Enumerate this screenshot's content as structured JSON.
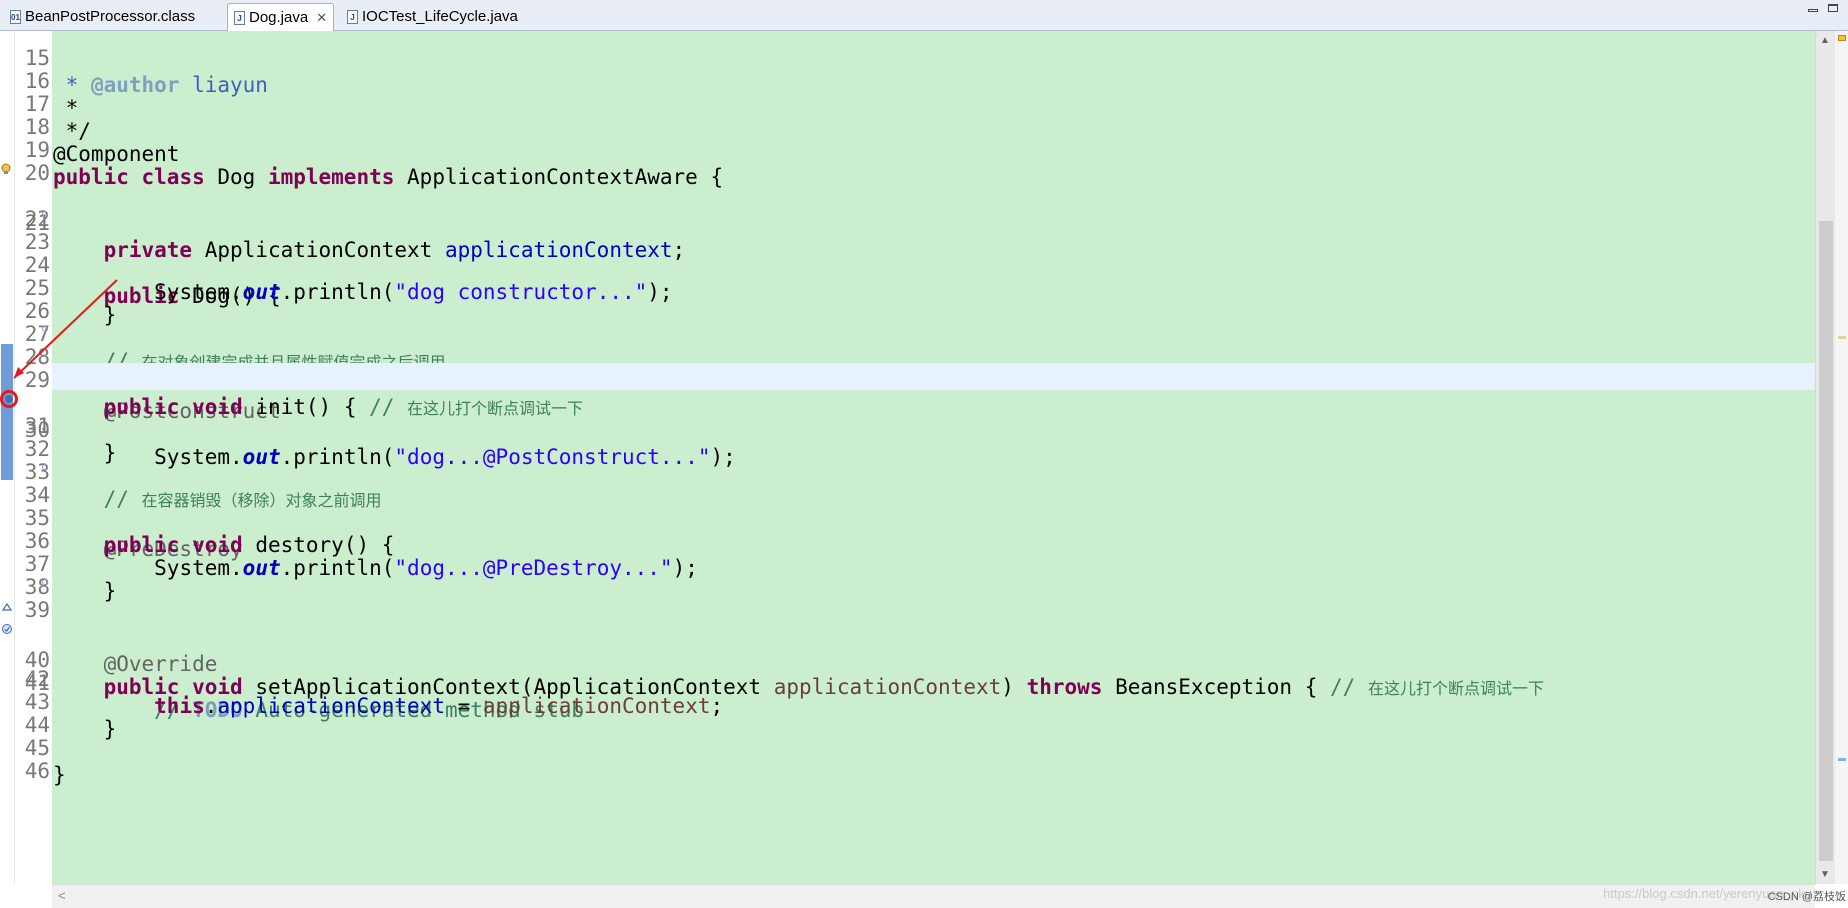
{
  "tabs": [
    {
      "label": "BeanPostProcessor.class",
      "icon": "class-file-icon",
      "active": false
    },
    {
      "label": "Dog.java",
      "icon": "java-file-icon",
      "active": true,
      "close": "✕"
    },
    {
      "label": "IOCTest_LifeCycle.java",
      "icon": "java-file-icon",
      "active": false
    }
  ],
  "watermark": "https://blog.csdn.net/yerenyuan_pku",
  "watermark_brand": "CSDN @荔枝饭",
  "colors": {
    "code_background": "#cbeecf",
    "current_line": "#e8f2fe",
    "keyword": "#7f0055",
    "string": "#2a00ff",
    "comment": "#3f7f5f",
    "annotation": "#646464",
    "field": "#0000c0",
    "breakpoint_marker": "#e11b1b"
  },
  "current_line": 30,
  "lines": [
    {
      "n": "15"
    },
    {
      "n": "16"
    },
    {
      "n": "17"
    },
    {
      "n": "18"
    },
    {
      "n": "19"
    },
    {
      "n": "20"
    },
    {
      "n": "21"
    },
    {
      "n": "22"
    },
    {
      "n": "23"
    },
    {
      "n": "24"
    },
    {
      "n": "25"
    },
    {
      "n": "26"
    },
    {
      "n": "27"
    },
    {
      "n": "28"
    },
    {
      "n": "29"
    },
    {
      "n": "30"
    },
    {
      "n": "31"
    },
    {
      "n": "32"
    },
    {
      "n": "33"
    },
    {
      "n": "34"
    },
    {
      "n": "35"
    },
    {
      "n": "36"
    },
    {
      "n": "37"
    },
    {
      "n": "38"
    },
    {
      "n": "39"
    },
    {
      "n": "40"
    },
    {
      "n": "41"
    },
    {
      "n": "42"
    },
    {
      "n": "43"
    },
    {
      "n": "44"
    },
    {
      "n": "45"
    },
    {
      "n": "46"
    }
  ],
  "code": {
    "l15_a": " * ",
    "l15_b": "@author",
    "l15_c": " liayun",
    "l16": " *",
    "l17": " */",
    "l18": "@Component",
    "l19_kw1": "public",
    "l19_kw2": "class",
    "l19_name": " Dog ",
    "l19_kw3": "implements",
    "l19_rest": " ApplicationContextAware {",
    "l21_kw": "private",
    "l21_type": " ApplicationContext ",
    "l21_field": "applicationContext",
    "l21_end": ";",
    "l23_kw": "public",
    "l23_rest": " Dog() {",
    "l24_a": "System.",
    "l24_out": "out",
    "l24_b": ".println(",
    "l24_str": "\"dog constructor...\"",
    "l24_end": ");",
    "l25": "}",
    "l27_slash": "// ",
    "l27_cn": "在对象创建完成并且属性赋值完成之后调用",
    "l28": "@PostConstruct",
    "l29_kw1": "public",
    "l29_kw2": "void",
    "l29_rest": " init() { ",
    "l29_slash": "// ",
    "l29_cn": "在这儿打个断点调试一下",
    "l30_a": "System.",
    "l30_out": "out",
    "l30_b": ".println(",
    "l30_str": "\"dog...@PostConstruct...\"",
    "l30_end": ");",
    "l31": "}",
    "l33_slash": "// ",
    "l33_cn": "在容器销毁（移除）对象之前调用",
    "l34": "@PreDestroy",
    "l35_kw1": "public",
    "l35_kw2": "void",
    "l35_rest": " destory() {",
    "l36_a": "System.",
    "l36_out": "out",
    "l36_b": ".println(",
    "l36_str": "\"dog...@PreDestroy...\"",
    "l36_end": ");",
    "l37": "}",
    "l39": "@Override",
    "l40_kw1": "public",
    "l40_kw2": "void",
    "l40_a": " setApplicationContext(ApplicationContext ",
    "l40_prm": "applicationContext",
    "l40_b": ") ",
    "l40_kw3": "throws",
    "l40_c": " BeansException { ",
    "l40_slash": "// ",
    "l40_cn": "在这儿打个断点调试一下",
    "l41_slash": "// ",
    "l41_todo": "TODO",
    "l41_rest": " Auto-generated method stub",
    "l42_kw": "this",
    "l42_a": ".",
    "l42_fld": "applicationContext",
    "l42_b": " = ",
    "l42_prm": "applicationContext",
    "l42_end": ";",
    "l43": "}",
    "l45": "}"
  }
}
